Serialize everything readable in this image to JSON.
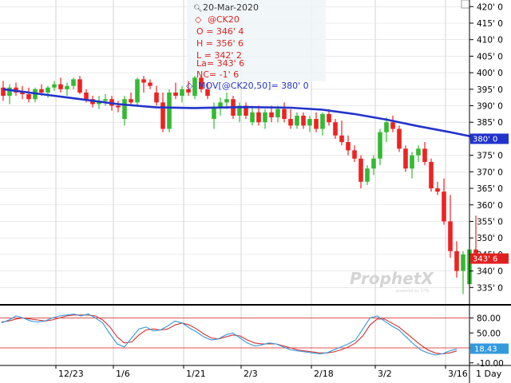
{
  "chart_data": {
    "type": "candlestick",
    "symbol_label": "@CK20",
    "ohlc_info": {
      "date": "20-Mar-2020",
      "symbol": "@CK20",
      "open": "O = 346' 4",
      "high": "H = 356' 6",
      "low": "L = 342' 2",
      "last": "La= 343' 6",
      "net_change": "NC= -1' 6",
      "moving_average": "MOV[@CK20,50]= 380' 0"
    },
    "y_range": [
      330,
      422
    ],
    "y_ticks": [
      "420' 0",
      "415' 0",
      "410' 0",
      "405' 0",
      "400' 0",
      "395' 0",
      "390' 0",
      "385' 0",
      "380' 0",
      "375' 0",
      "370' 0",
      "365' 0",
      "360' 0",
      "355' 0",
      "350' 0",
      "345' 0",
      "340' 0",
      "335' 0"
    ],
    "y_tick_values": [
      420,
      415,
      410,
      405,
      400,
      395,
      390,
      385,
      380,
      375,
      370,
      365,
      360,
      355,
      350,
      345,
      340,
      335
    ],
    "x_labels": [
      "12/23",
      "1/6",
      "1/21",
      "2/3",
      "2/18",
      "3/2",
      "3/16"
    ],
    "x_label_index": [
      9,
      18,
      29,
      38,
      49,
      59,
      70
    ],
    "x_timeframe": "1 Day",
    "last_price_label": "343' 6",
    "last_price_value": 343.75,
    "ma_label": "380' 0",
    "ma_value": 380,
    "watermark": "ProphetX",
    "watermark_sub": "powered by DTN",
    "candles": [
      [
        395.5,
        397.5,
        391.5,
        393
      ],
      [
        393,
        396.5,
        390.5,
        395.5
      ],
      [
        395.5,
        397,
        393,
        394
      ],
      [
        394,
        396,
        392,
        393.5
      ],
      [
        393.5,
        395.5,
        391,
        392
      ],
      [
        392,
        395.5,
        391,
        395
      ],
      [
        395,
        396.5,
        393,
        394
      ],
      [
        394,
        396,
        392.5,
        395.5
      ],
      [
        395.5,
        397.5,
        394.5,
        396.5
      ],
      [
        396.5,
        398.5,
        394,
        395
      ],
      [
        395,
        397,
        393,
        396
      ],
      [
        396,
        398.5,
        395,
        398
      ],
      [
        398,
        399,
        393.5,
        394
      ],
      [
        394,
        395,
        391,
        392
      ],
      [
        392,
        393,
        389.5,
        390.5
      ],
      [
        390.5,
        393,
        389,
        391.5
      ],
      [
        391.5,
        393.5,
        390,
        392
      ],
      [
        392,
        393,
        388.5,
        390
      ],
      [
        390,
        391.5,
        388,
        389.5
      ],
      [
        386,
        393,
        384,
        392
      ],
      [
        392,
        394,
        390,
        391
      ],
      [
        391,
        398.5,
        390,
        398
      ],
      [
        398,
        399,
        394,
        397
      ],
      [
        397,
        398,
        395,
        396
      ],
      [
        394,
        396,
        390,
        391
      ],
      [
        391,
        394,
        382,
        383
      ],
      [
        383,
        395,
        382,
        394
      ],
      [
        394,
        397,
        392,
        393
      ],
      [
        393,
        396,
        391,
        395
      ],
      [
        395,
        397.5,
        393,
        394
      ],
      [
        393,
        399,
        392,
        398.5
      ],
      [
        398.5,
        399,
        394,
        395
      ],
      [
        395,
        397,
        392,
        393
      ],
      [
        386,
        391,
        383,
        389.5
      ],
      [
        389.5,
        392.5,
        387,
        391
      ],
      [
        391,
        394,
        389,
        392
      ],
      [
        392,
        393,
        386,
        387
      ],
      [
        387,
        391,
        385,
        390
      ],
      [
        390,
        391,
        386,
        387
      ],
      [
        385,
        390,
        384,
        388
      ],
      [
        388,
        390,
        384,
        385
      ],
      [
        385,
        389,
        383,
        388
      ],
      [
        388,
        390,
        385,
        386.5
      ],
      [
        386.5,
        390,
        385,
        389
      ],
      [
        389,
        391,
        385,
        386
      ],
      [
        386,
        389,
        383,
        384
      ],
      [
        384,
        388,
        383,
        387
      ],
      [
        387,
        388,
        383,
        384
      ],
      [
        384,
        387,
        382,
        386
      ],
      [
        386,
        388,
        382,
        383
      ],
      [
        383,
        388,
        381,
        387.5
      ],
      [
        387.5,
        389,
        384,
        385
      ],
      [
        385,
        386,
        380,
        381
      ],
      [
        381,
        385.5,
        378,
        379
      ],
      [
        379,
        381,
        375,
        376.5
      ],
      [
        376.5,
        378,
        373,
        374
      ],
      [
        374,
        375,
        365,
        367
      ],
      [
        367,
        372,
        366,
        371
      ],
      [
        371,
        375,
        369,
        374
      ],
      [
        374,
        383,
        372,
        382
      ],
      [
        382,
        386.5,
        379,
        385
      ],
      [
        385,
        387,
        382,
        383
      ],
      [
        383,
        384,
        376,
        377
      ],
      [
        377,
        378,
        370,
        371
      ],
      [
        371,
        376,
        368,
        375
      ],
      [
        375,
        378,
        373,
        377
      ],
      [
        377,
        379,
        372,
        373
      ],
      [
        373,
        374,
        364,
        365
      ],
      [
        365,
        367,
        363,
        364
      ],
      [
        364,
        368,
        354,
        355
      ],
      [
        355,
        363,
        344,
        346
      ],
      [
        346,
        349,
        338,
        340
      ],
      [
        340,
        346,
        333,
        345
      ],
      [
        336,
        355,
        336,
        346.5
      ],
      [
        346.5,
        356.75,
        342.25,
        343.75
      ]
    ],
    "ma_points": [
      [
        0,
        395
      ],
      [
        6,
        393.5
      ],
      [
        12,
        392
      ],
      [
        18,
        390.5
      ],
      [
        24,
        389.5
      ],
      [
        30,
        389.3
      ],
      [
        38,
        389.6
      ],
      [
        45,
        389.4
      ],
      [
        50,
        388.8
      ],
      [
        55,
        387.5
      ],
      [
        60,
        385.8
      ],
      [
        65,
        383.8
      ],
      [
        70,
        382
      ],
      [
        75,
        380
      ]
    ],
    "oscillator": {
      "range": [
        -12,
        100
      ],
      "ticks": [
        "80.00",
        "50.00",
        "20.00",
        "-10.00"
      ],
      "tick_values": [
        80,
        50,
        20,
        -10
      ],
      "bands": [
        80,
        20
      ],
      "current_label": "18.43",
      "k_line": [
        70,
        76,
        84,
        80,
        74,
        72,
        74,
        80,
        84,
        86,
        88,
        84,
        88,
        80,
        70,
        48,
        28,
        22,
        40,
        58,
        62,
        54,
        56,
        64,
        74,
        70,
        60,
        52,
        42,
        36,
        38,
        46,
        50,
        40,
        30,
        24,
        26,
        30,
        28,
        22,
        16,
        14,
        12,
        10,
        8,
        10,
        16,
        22,
        28,
        36,
        58,
        80,
        84,
        74,
        64,
        56,
        42,
        28,
        16,
        10,
        6,
        8,
        14,
        18
      ],
      "d_line": [
        72,
        74,
        78,
        80,
        78,
        76,
        74,
        76,
        80,
        84,
        86,
        86,
        86,
        84,
        76,
        62,
        42,
        30,
        32,
        46,
        56,
        58,
        56,
        58,
        66,
        70,
        66,
        58,
        48,
        40,
        38,
        42,
        46,
        44,
        36,
        30,
        28,
        28,
        28,
        24,
        20,
        16,
        14,
        12,
        10,
        10,
        12,
        16,
        22,
        30,
        44,
        66,
        78,
        78,
        70,
        62,
        50,
        38,
        26,
        16,
        10,
        8,
        10,
        14
      ]
    }
  }
}
